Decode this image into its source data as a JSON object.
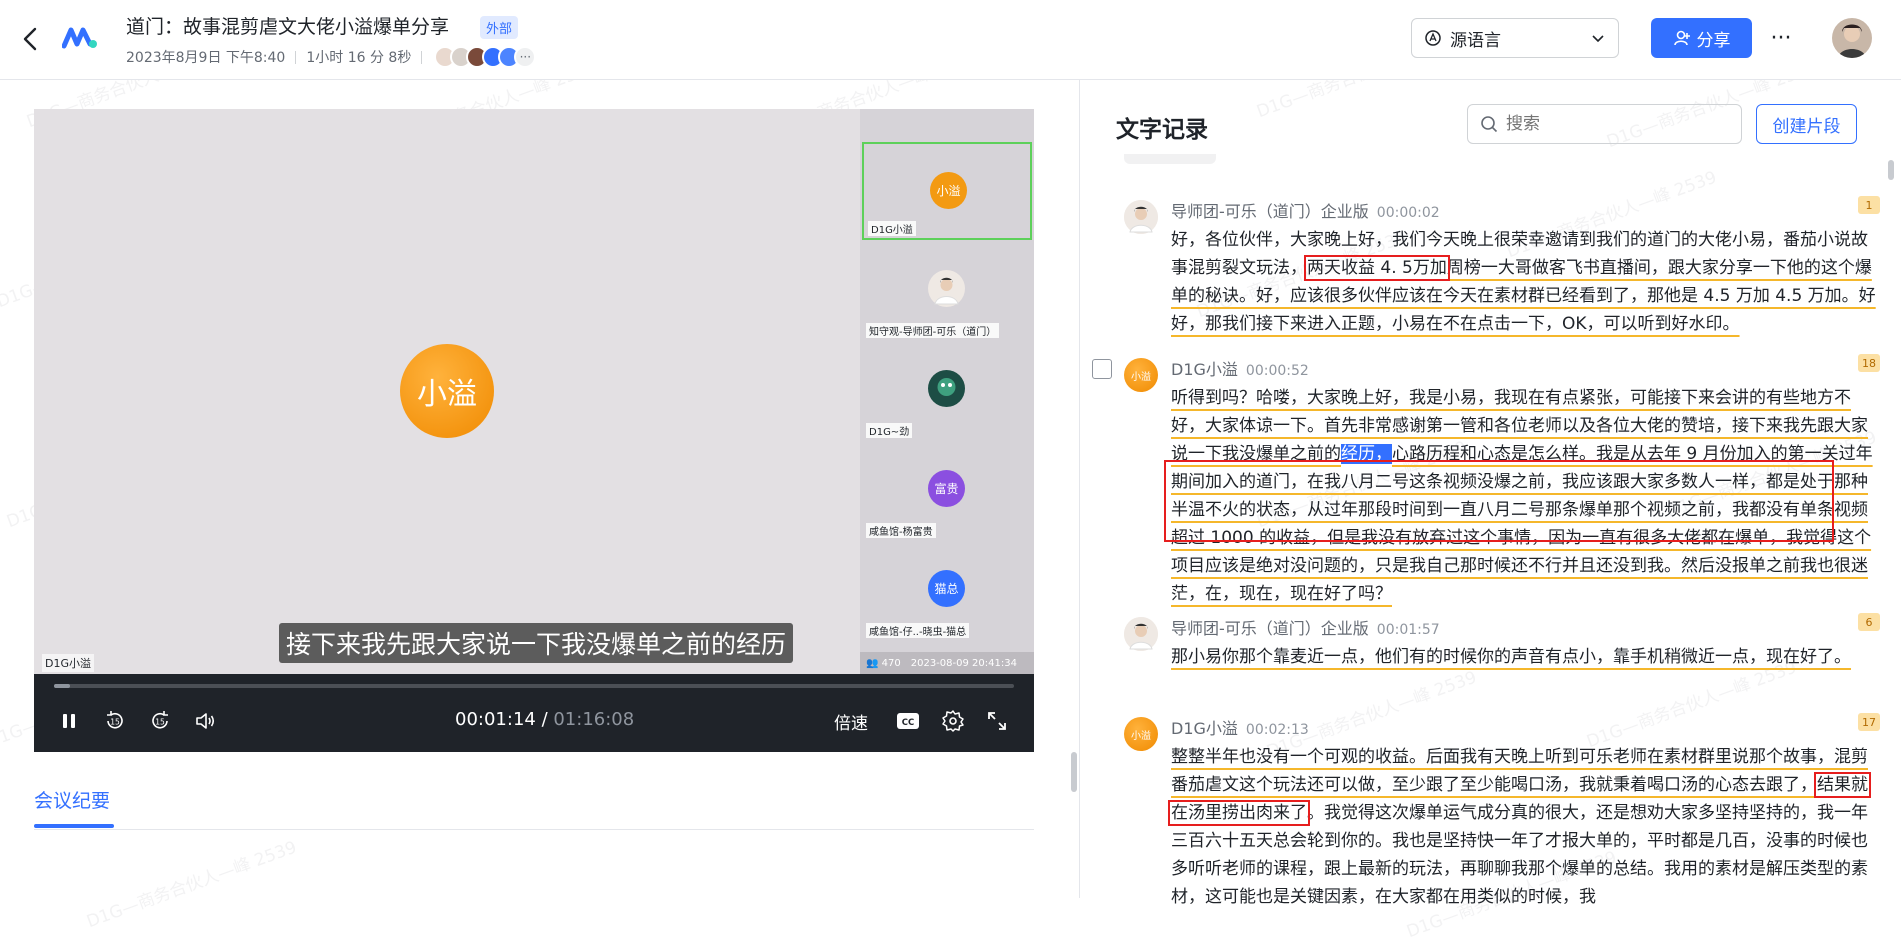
{
  "header": {
    "title": "道门：故事混剪虐文大佬小溢爆单分享",
    "external_tag": "外部",
    "date": "2023年8月9日 下午8:40",
    "duration": "1小时 16 分 8秒",
    "participants_more": "···",
    "language_select": "源语言",
    "share_label": "分享",
    "more_label": "···"
  },
  "video": {
    "main_avatar_label": "小溢",
    "main_name": "D1G小溢",
    "subtitle": "接下来我先跟大家说一下我没爆单之前的经历",
    "tiles": [
      {
        "avatar": "小溢",
        "name": "D1G小溢",
        "color": "#f39a12",
        "active": true
      },
      {
        "avatar": "",
        "name": "知守观-导师团-可乐（道门）",
        "color": "#efe9e4",
        "active": false
      },
      {
        "avatar": "",
        "name": "D1G~劲",
        "color": "#2e7d6b",
        "active": false
      },
      {
        "avatar": "富贵",
        "name": "咸鱼馆-杨富贵",
        "color": "#8b4fe0",
        "active": false
      },
      {
        "avatar": "猫总",
        "name": "咸鱼馆-仔..-晓虫-猫总",
        "color": "#3370ff",
        "active": false
      }
    ],
    "viewers": "470",
    "stream_time": "2023-08-09 20:41:34",
    "current_time": "00:01:14",
    "total_time": "01:16:08",
    "progress": 0.0162,
    "speed_label": "倍速"
  },
  "tabs": {
    "minutes": "会议纪要"
  },
  "transcript": {
    "title": "文字记录",
    "search_placeholder": "搜索",
    "create_clip": "创建片段",
    "entries": [
      {
        "speaker": "导师团-可乐（道门）企业版",
        "time": "00:00:02",
        "badge": "1",
        "t1": "好，各位伙伴，大家晚上好，我们今天晚上很荣幸邀请到我们的道门的大佬小易，番茄小说故事混剪裂文玩法，",
        "t2": "两天收益 4. 5万加",
        "t3": "周榜一大哥做客飞书直播间，跟大家分享一下他的这个爆单的秘诀。好，应该很多伙伴应该在今天在素材群已经看到了，那他是 4.5 万加 4.5 万加。好好，那我们接下来进入正题，小易在不在点击一下，OK，可以听到好水印。"
      },
      {
        "speaker": "D1G小溢",
        "time": "00:00:52",
        "badge": "18",
        "t1": "听得到吗？哈喽，大家晚上好，我是小易，我现在有点紧张，可能接下来会讲的有些地方不好，大家体谅一下。首先非常感谢第一管和各位老师以及各位大佬的赞培，接下来我先跟大家说一下我没爆单之前的",
        "t2": "经历，",
        "t3": "心路历程和心态是怎么样。我是从去年 9 月份加入的第一关过年期间加入的道门，在我八月二号这条视频没爆之前，我应该跟大家多数人一样，都是处于那种半温不火的状态，从过年那段时间到一直八月二号那条爆单那个视频之前，我都没有单条视频超过 1000 的收益，但是我没有放弃过这个事情，因为一直有很多大佬都在爆单，我觉得这个项目应该是绝对没问题的，只是我自己那时候还不行并且还没到我。然后没报单之前我也很迷茫，在，现在，现在好了吗？"
      },
      {
        "speaker": "导师团-可乐（道门）企业版",
        "time": "00:01:57",
        "badge": "6",
        "t1": "那小易你那个靠麦近一点，他们有的时候你的声音有点小，靠手机稍微近一点，现在好了。"
      },
      {
        "speaker": "D1G小溢",
        "time": "00:02:13",
        "badge": "17",
        "t1": "整整半年也没有一个可观的收益。后面我有天晚上听到可乐老师在素材群里说那个故事，混剪番茄虐文这个玩法还可以做，至少跟了至少能喝口汤，我就秉着喝口汤的心态去跟了，",
        "t2": "结果就在汤里捞出肉来了",
        "t3": "。我觉得这次爆单运气成分真的很大，还是想劝大家多坚持坚持的，我一年三百六十五天总会轮到你的。我也是坚持快一年了才报大单的，平时都是几百，没事的时候也多听听老师的课程，跟上最新的玩法，再聊聊我那个爆单的总结。我用的素材是解压类型的素材，这可能也是关键因素，在大家都在用类似的时候，我"
      }
    ]
  },
  "watermark": "D1G—商务合伙人—峰 2539",
  "colors": {
    "accent": "#3370ff",
    "highlight_box": "#e61e1e",
    "underline": "#f5b72b",
    "active_tile": "#5dd05a"
  }
}
